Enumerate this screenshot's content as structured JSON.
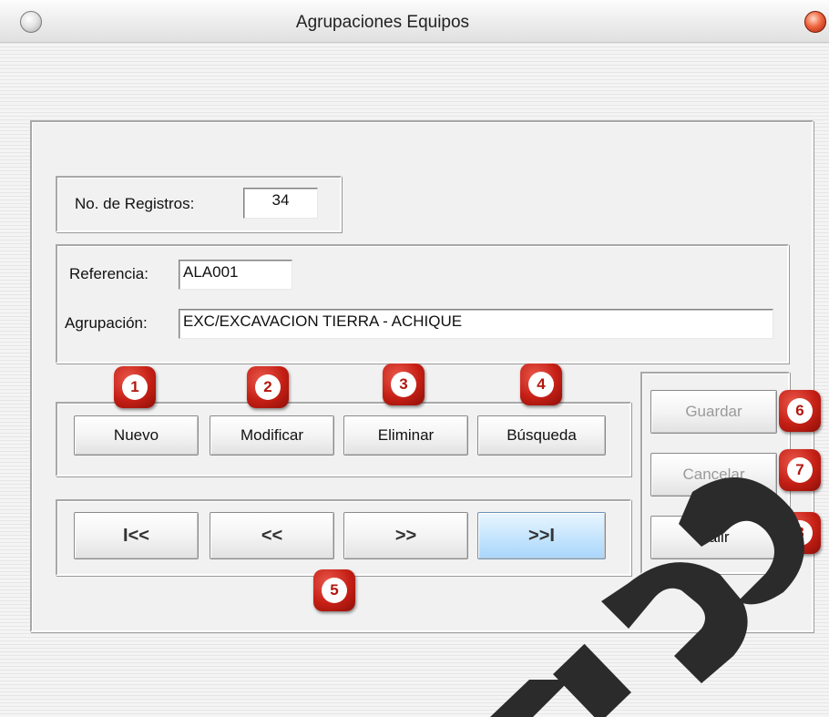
{
  "window": {
    "title": "Agrupaciones Equipos"
  },
  "registros": {
    "label": "No. de Registros:",
    "value": "34"
  },
  "form": {
    "referencia_label": "Referencia:",
    "referencia_value": "ALA001",
    "agrupacion_label": "Agrupación:",
    "agrupacion_value": "EXC/EXCAVACION TIERRA - ACHIQUE"
  },
  "actions": {
    "nuevo": "Nuevo",
    "modificar": "Modificar",
    "eliminar": "Eliminar",
    "busqueda": "Búsqueda"
  },
  "navigation": {
    "first": "I<<",
    "prev": "<<",
    "next": ">>",
    "last": ">>I",
    "active": "last"
  },
  "side": {
    "guardar": "Guardar",
    "cancelar": "Cancelar",
    "salir": "Salir",
    "disabled": [
      "guardar",
      "cancelar"
    ]
  },
  "callouts": [
    "1",
    "2",
    "3",
    "4",
    "5",
    "6",
    "7",
    "8"
  ],
  "colors": {
    "badge_red": "#c51f15",
    "active_button": "#c8e6fd",
    "close_button": "#f0663f"
  },
  "icons": {
    "window_menu": "circle-gray-icon",
    "window_close": "circle-red-icon"
  }
}
